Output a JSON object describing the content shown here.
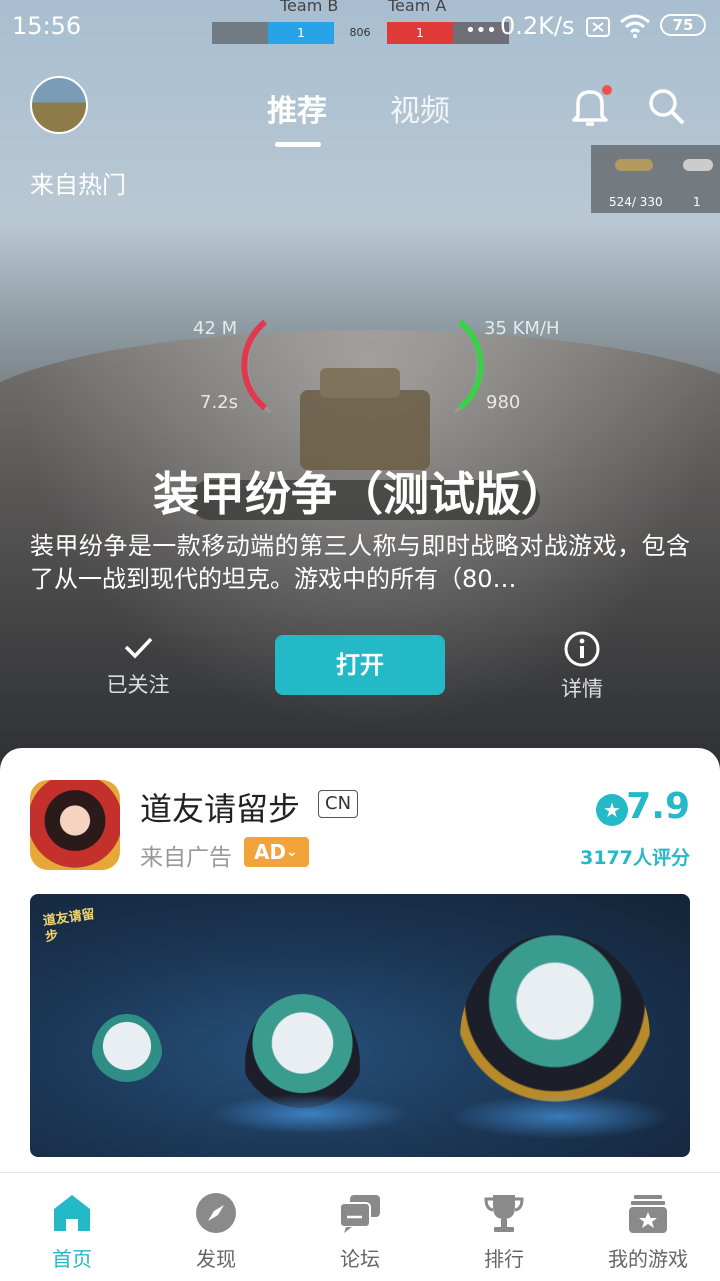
{
  "status_bar": {
    "time": "15:56",
    "network_speed": "0.2K/s",
    "battery": "75"
  },
  "game_hud": {
    "team_b_label": "Team B",
    "team_a_label": "Team A",
    "team_b_score": "1",
    "team_a_score": "1",
    "center_value": "806",
    "distance": "42 M",
    "timer": "7.2s",
    "speed": "35 KM/H",
    "hp": "980",
    "ammo": "524/ 330",
    "ammo_count": "1"
  },
  "header": {
    "tabs": [
      {
        "label": "推荐",
        "active": true
      },
      {
        "label": "视频",
        "active": false
      }
    ],
    "source_label": "来自热门"
  },
  "featured": {
    "title": "装甲纷争（测试版）",
    "description": "装甲纷争是一款移动端的第三人称与即时战略对战游戏，包含了从一战到现代的坦克。游戏中的所有（80…",
    "followed_label": "已关注",
    "open_label": "打开",
    "details_label": "详情"
  },
  "ad_card": {
    "name": "道友请留步",
    "region_tag": "CN",
    "source_label": "来自广告",
    "ad_badge": "AD",
    "rating": "7.9",
    "rating_count": "3177人评分",
    "banner_logo_text": "道友请留步"
  },
  "tab_bar": {
    "items": [
      {
        "label": "首页",
        "icon": "home-icon",
        "active": true
      },
      {
        "label": "发现",
        "icon": "compass-icon",
        "active": false
      },
      {
        "label": "论坛",
        "icon": "chat-icon",
        "active": false
      },
      {
        "label": "排行",
        "icon": "trophy-icon",
        "active": false
      },
      {
        "label": "我的游戏",
        "icon": "my-games-icon",
        "active": false
      }
    ]
  },
  "colors": {
    "accent": "#23b9c6",
    "ad_badge": "#f2a33a",
    "team_b": "#29a3e8",
    "team_a": "#e0393a"
  }
}
